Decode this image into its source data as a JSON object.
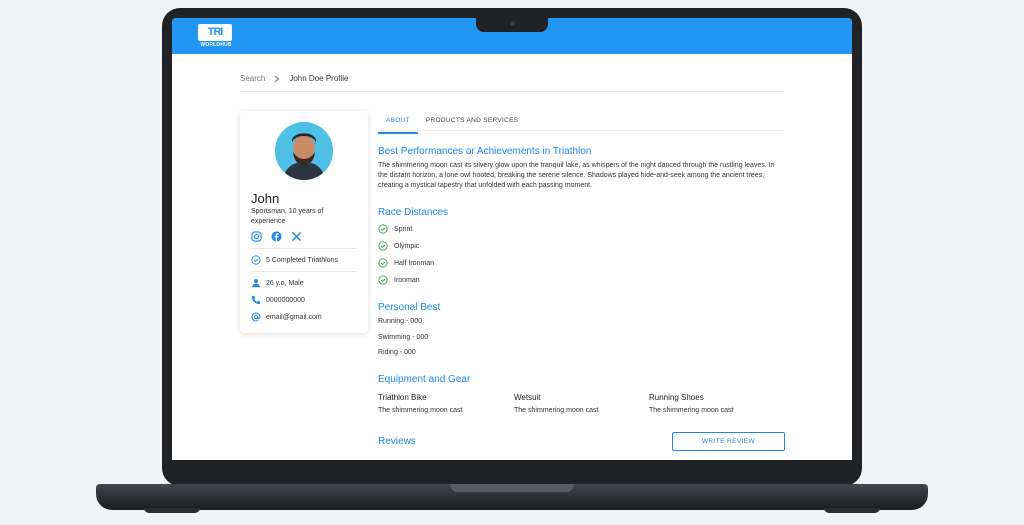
{
  "header": {
    "logo_text": "TRI",
    "logo_sub": "WORLDHUB",
    "accent": "#2196f3"
  },
  "breadcrumb": {
    "root": "Search",
    "current": "John Doe Profile"
  },
  "profile": {
    "name": "John",
    "bio": "Sportsman, 10 years of experience",
    "socials": [
      "instagram-icon",
      "facebook-icon",
      "x-icon"
    ],
    "completed": "5 Completed Triathlons",
    "age_gender": "26 y.o, Male",
    "phone": "0000000000",
    "email": "email@gmail.com"
  },
  "tabs": [
    {
      "label": "ABOUT",
      "active": true
    },
    {
      "label": "PRODUCTS AND SERVICES",
      "active": false
    }
  ],
  "about": {
    "achievements_title": "Best Performances or Achievements in Triathlon",
    "achievements_text": "The shimmering moon cast its silvery glow upon the tranquil lake, as whispers of the night danced through the rustling leaves. In the distant horizon, a lone owl hooted, breaking the serene silence. Shadows played hide-and-seek among the ancient trees, creating a mystical tapestry that unfolded with each passing moment.",
    "distances_title": "Race Distances",
    "distances": [
      "Sprint",
      "Olympic",
      "Half Ironman",
      "Ironman"
    ],
    "personal_best_title": "Personal Best",
    "personal_best": [
      "Running - 000",
      "Swimming - 000",
      "Riding - 000"
    ],
    "equipment_title": "Equipment and Gear",
    "equipment": [
      {
        "title": "Triathlon Bike",
        "desc": "The shimmering moon cast"
      },
      {
        "title": "Wetsuit",
        "desc": "The shimmering moon cast"
      },
      {
        "title": "Running Shoes",
        "desc": "The shimmering moon cast"
      }
    ],
    "reviews_title": "Reviews",
    "write_review": "WRITE REVIEW"
  }
}
